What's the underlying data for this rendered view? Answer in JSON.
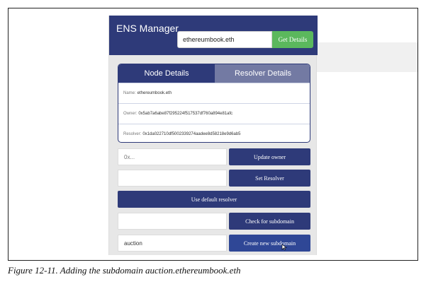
{
  "app": {
    "title": "ENS Manager",
    "search": {
      "value": "ethereumbook.eth"
    },
    "get_details_label": "Get Details"
  },
  "tabs": [
    {
      "label": "Node Details",
      "active": true
    },
    {
      "label": "Resolver Details",
      "active": false
    }
  ],
  "details": {
    "name_label": "Name:",
    "name_value": "ethereumbook.eth",
    "owner_label": "Owner:",
    "owner_value": "0x5ab7a6abe87f295224f517537df760a894e81afc",
    "resolver_label": "Resolver:",
    "resolver_value": "0x1da022710df5002339274aadee8d58218e9d6ab5"
  },
  "controls": {
    "owner_placeholder": "0x...",
    "update_owner_label": "Update owner",
    "resolver_placeholder": "",
    "set_resolver_label": "Set Resolver",
    "default_resolver_label": "Use default resolver",
    "subdomain_check_value": "",
    "check_subdomain_label": "Check for subdomain",
    "subdomain_value": "auction",
    "create_subdomain_label": "Create new subdomain"
  },
  "caption": "Figure 12-11. Adding the subdomain auction.ethereumbook.eth",
  "colors": {
    "header_bg": "#2e3a79",
    "accent_green": "#5bb85d",
    "tab_inactive": "#737aa3",
    "button_bg": "#2e3a79"
  }
}
